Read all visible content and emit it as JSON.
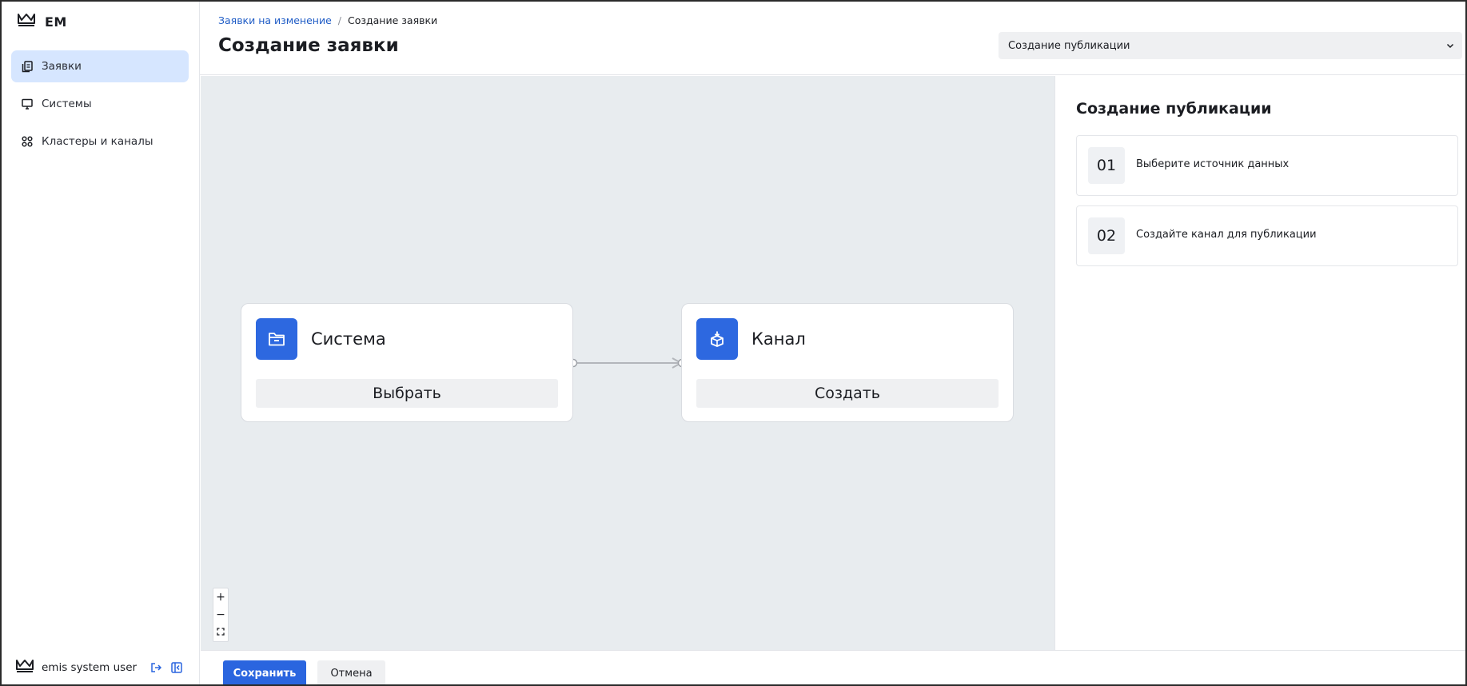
{
  "app": {
    "logo_text": "EM"
  },
  "sidebar": {
    "items": [
      {
        "label": "Заявки",
        "icon": "documents-icon",
        "active": true
      },
      {
        "label": "Системы",
        "icon": "monitor-icon",
        "active": false
      },
      {
        "label": "Кластеры и каналы",
        "icon": "grid-icon",
        "active": false
      }
    ],
    "user": {
      "name": "emis system user"
    }
  },
  "header": {
    "breadcrumb": {
      "parent": "Заявки на изменение",
      "separator": "/",
      "current": "Создание заявки"
    },
    "title": "Создание заявки",
    "type_select": {
      "value": "Создание публикации"
    }
  },
  "flow": {
    "nodes": [
      {
        "title": "Система",
        "button": "Выбрать",
        "icon": "folder-icon"
      },
      {
        "title": "Канал",
        "button": "Создать",
        "icon": "box-download-icon"
      }
    ],
    "zoom_controls": {
      "zoom_in": "+",
      "zoom_out": "−"
    }
  },
  "panel": {
    "title": "Создание публикации",
    "steps": [
      {
        "num": "01",
        "text": "Выберите источник данных"
      },
      {
        "num": "02",
        "text": "Создайте канал для публикации"
      }
    ]
  },
  "footer": {
    "save": "Сохранить",
    "cancel": "Отмена"
  },
  "colors": {
    "accent": "#2d68e0",
    "active_nav": "#d6e6ff",
    "canvas_bg": "#e8ecef"
  }
}
